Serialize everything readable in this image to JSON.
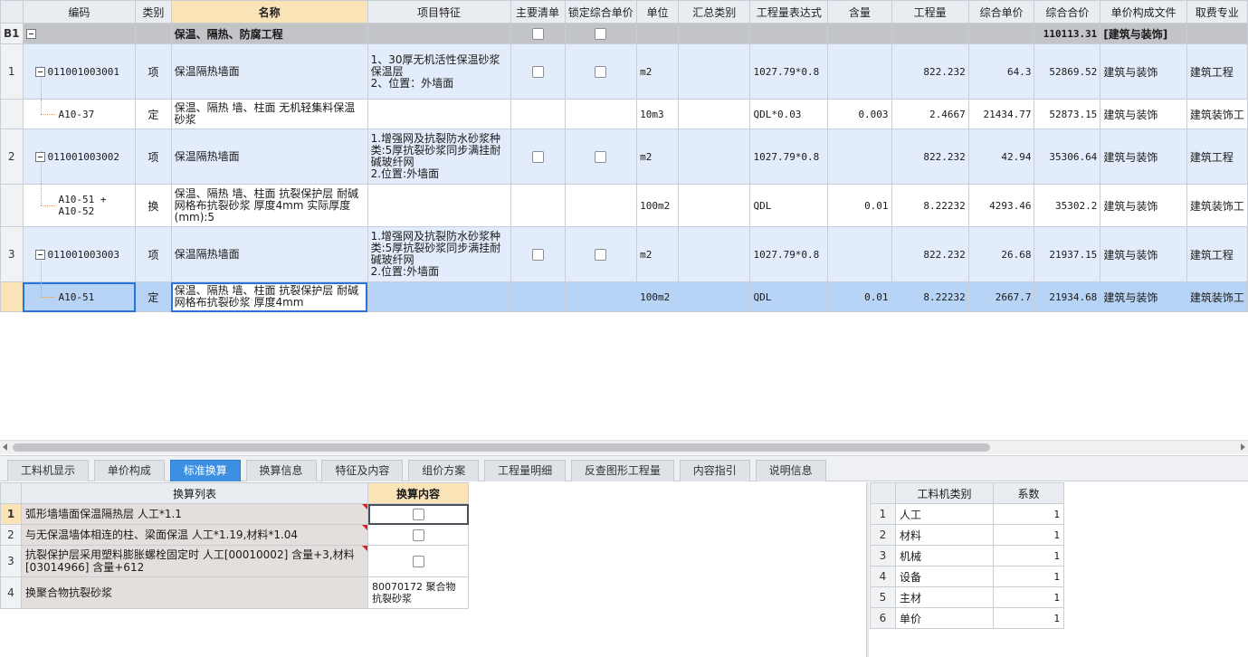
{
  "main_grid": {
    "headers": [
      "编码",
      "类别",
      "名称",
      "项目特征",
      "主要清单",
      "锁定综合单价",
      "单位",
      "汇总类别",
      "工程量表达式",
      "含量",
      "工程量",
      "综合单价",
      "综合合价",
      "单价构成文件",
      "取费专业"
    ],
    "section": {
      "rowno": "B1",
      "name": "保温、隔热、防腐工程",
      "total": "110113.31",
      "file": "[建筑与装饰]"
    },
    "rows": [
      {
        "rowno": "1",
        "code": "011001003001",
        "type": "项",
        "name": "保温隔热墙面",
        "feature": "1、30厚无机活性保温砂浆保温层\n2、位置：外墙面",
        "unit": "m2",
        "expr": "1027.79*0.8",
        "content": "",
        "qty": "822.232",
        "price": "64.3",
        "total": "52869.52",
        "file": "建筑与装饰",
        "fee": "建筑工程"
      },
      {
        "rowno": "",
        "code": "A10-37",
        "type": "定",
        "name": "保温、隔热 墙、柱面 无机轻集料保温砂浆",
        "feature": "",
        "unit": "10m3",
        "expr": "QDL*0.03",
        "content": "0.003",
        "qty": "2.4667",
        "price": "21434.77",
        "total": "52873.15",
        "file": "建筑与装饰",
        "fee": "建筑装饰工"
      },
      {
        "rowno": "2",
        "code": "011001003002",
        "type": "项",
        "name": "保温隔热墙面",
        "feature": "1.增强网及抗裂防水砂浆种类:5厚抗裂砂浆同步满挂耐碱玻纤网\n2.位置:外墙面",
        "unit": "m2",
        "expr": "1027.79*0.8",
        "content": "",
        "qty": "822.232",
        "price": "42.94",
        "total": "35306.64",
        "file": "建筑与装饰",
        "fee": "建筑工程"
      },
      {
        "rowno": "",
        "code": "A10-51 +\nA10-52",
        "type": "换",
        "name": "保温、隔热 墙、柱面 抗裂保护层 耐碱网格布抗裂砂浆 厚度4mm  实际厚度(mm):5",
        "feature": "",
        "unit": "100m2",
        "expr": "QDL",
        "content": "0.01",
        "qty": "8.22232",
        "price": "4293.46",
        "total": "35302.2",
        "file": "建筑与装饰",
        "fee": "建筑装饰工"
      },
      {
        "rowno": "3",
        "code": "011001003003",
        "type": "项",
        "name": "保温隔热墙面",
        "feature": "1.增强网及抗裂防水砂浆种类:5厚抗裂砂浆同步满挂耐碱玻纤网\n2.位置:外墙面",
        "unit": "m2",
        "expr": "1027.79*0.8",
        "content": "",
        "qty": "822.232",
        "price": "26.68",
        "total": "21937.15",
        "file": "建筑与装饰",
        "fee": "建筑工程"
      },
      {
        "rowno": "",
        "code": "A10-51",
        "type": "定",
        "name": "保温、隔热 墙、柱面 抗裂保护层 耐碱网格布抗裂砂浆 厚度4mm",
        "feature": "",
        "unit": "100m2",
        "expr": "QDL",
        "content": "0.01",
        "qty": "8.22232",
        "price": "2667.7",
        "total": "21934.68",
        "file": "建筑与装饰",
        "fee": "建筑装饰工"
      }
    ]
  },
  "tabs": [
    "工料机显示",
    "单价构成",
    "标准换算",
    "换算信息",
    "特征及内容",
    "组价方案",
    "工程量明细",
    "反查图形工程量",
    "内容指引",
    "说明信息"
  ],
  "active_tab": "标准换算",
  "conversion": {
    "headers": [
      "换算列表",
      "换算内容"
    ],
    "rows": [
      {
        "rowno": "1",
        "label": "弧形墙墙面保温隔热层 人工*1.1",
        "value": ""
      },
      {
        "rowno": "2",
        "label": "与无保温墙体相连的柱、梁面保温 人工*1.19,材料*1.04",
        "value": ""
      },
      {
        "rowno": "3",
        "label": "抗裂保护层采用塑料膨胀螺栓固定时 人工[00010002] 含量+3,材料[03014966] 含量+612",
        "value": ""
      },
      {
        "rowno": "4",
        "label": "换聚合物抗裂砂浆",
        "value": "80070172  聚合物抗裂砂浆"
      }
    ]
  },
  "coefficients": {
    "headers": [
      "工料机类别",
      "系数"
    ],
    "rows": [
      {
        "rowno": "1",
        "category": "人工",
        "factor": "1"
      },
      {
        "rowno": "2",
        "category": "材料",
        "factor": "1"
      },
      {
        "rowno": "3",
        "category": "机械",
        "factor": "1"
      },
      {
        "rowno": "4",
        "category": "设备",
        "factor": "1"
      },
      {
        "rowno": "5",
        "category": "主材",
        "factor": "1"
      },
      {
        "rowno": "6",
        "category": "单价",
        "factor": "1"
      }
    ]
  }
}
